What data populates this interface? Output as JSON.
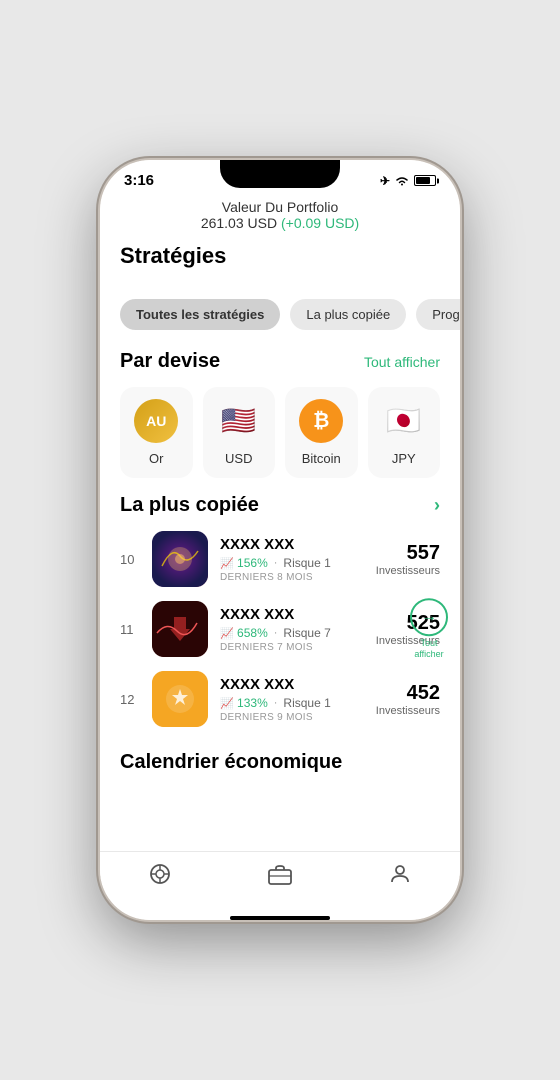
{
  "status_bar": {
    "time": "3:16",
    "airplane": "✈",
    "wifi": "wifi",
    "battery": "battery"
  },
  "header": {
    "title": "Valeur Du Portfolio",
    "value": "261.03 USD",
    "change": "(+0.09 USD)"
  },
  "strategies_section": {
    "title": "Stratégies",
    "filters": [
      {
        "label": "Toutes les stratégies",
        "active": true
      },
      {
        "label": "La plus copiée",
        "active": false
      },
      {
        "label": "Progressi",
        "active": false
      }
    ]
  },
  "devise_section": {
    "title": "Par devise",
    "tout_afficher": "Tout afficher",
    "items": [
      {
        "id": "or",
        "label": "Or",
        "symbol": "AU"
      },
      {
        "id": "usd",
        "label": "USD",
        "symbol": "🇺🇸"
      },
      {
        "id": "btc",
        "label": "Bitcoin",
        "symbol": "₿"
      },
      {
        "id": "jpy",
        "label": "JPY",
        "symbol": "🇯🇵"
      }
    ]
  },
  "copied_section": {
    "title": "La plus copiée",
    "tout_afficher": "Tout afficher",
    "strategies": [
      {
        "rank": "10",
        "name": "XXXX XXX",
        "percent": "156%",
        "risk_label": "Risque",
        "risk": "1",
        "period": "DERNIERS 8 MOIS",
        "investors_count": "557",
        "investors_label": "Investisseurs",
        "thumb_type": "1"
      },
      {
        "rank": "11",
        "name": "XXXX XXX",
        "percent": "658%",
        "risk_label": "Risque",
        "risk": "7",
        "period": "DERNIERS 7 MOIS",
        "investors_count": "525",
        "investors_label": "Investisseurs",
        "thumb_type": "2",
        "show_tout_afficher": true
      },
      {
        "rank": "12",
        "name": "XXXX XXX",
        "percent": "133%",
        "risk_label": "Risque",
        "risk": "1",
        "period": "DERNIERS 9 MOIS",
        "investors_count": "452",
        "investors_label": "Investisseurs",
        "thumb_type": "3"
      }
    ]
  },
  "calendrier": {
    "title": "Calendrier économique"
  },
  "bottom_nav": {
    "items": [
      {
        "icon": "📡",
        "label": "feed"
      },
      {
        "icon": "💼",
        "label": "portfolio"
      },
      {
        "icon": "👤",
        "label": "profile"
      }
    ]
  }
}
